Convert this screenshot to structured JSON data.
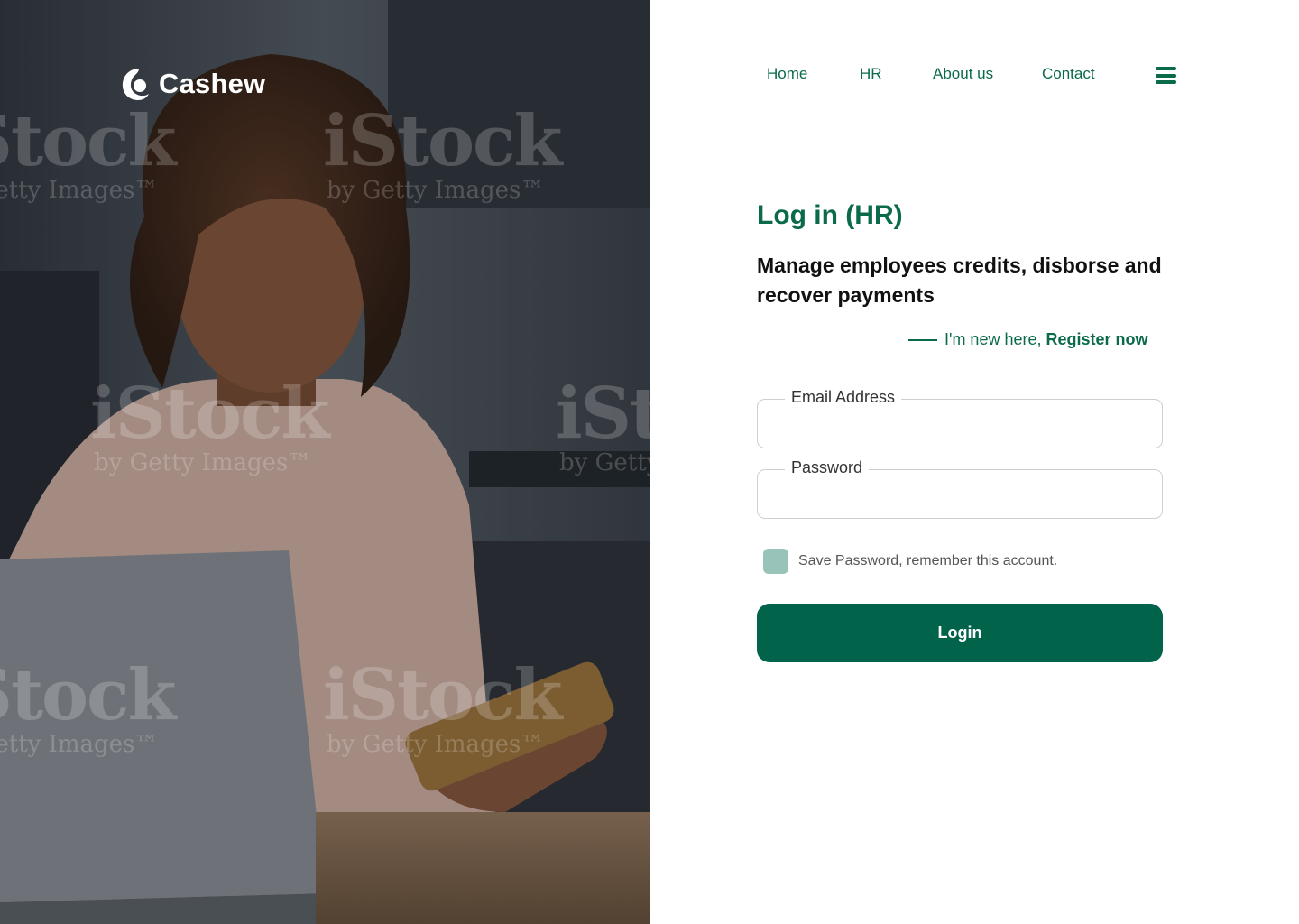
{
  "brand": {
    "name": "Cashew",
    "logo_icon": "cashew-logo-icon"
  },
  "hero": {
    "description_icon": "woman-with-laptop-and-card-photo",
    "watermark": {
      "main": "iStock",
      "sub": "by Getty Images™"
    }
  },
  "nav": {
    "items": [
      {
        "label": "Home"
      },
      {
        "label": "HR"
      },
      {
        "label": "About us"
      },
      {
        "label": "Contact"
      }
    ],
    "menu_icon": "hamburger-menu-icon"
  },
  "login": {
    "title": "Log in (HR)",
    "subtitle": "Manage employees credits, disborse and recover payments",
    "register_prompt": "I'm new here,",
    "register_link": "Register now",
    "email_label": "Email Address",
    "email_value": "",
    "password_label": "Password",
    "password_value": "",
    "remember_label": "Save Password, remember this account.",
    "remember_checked": false,
    "submit_label": "Login"
  },
  "colors": {
    "primary": "#01634a",
    "link": "#0b6a4b",
    "checkbox": "#98c3b8",
    "border": "#cfcfcf"
  }
}
